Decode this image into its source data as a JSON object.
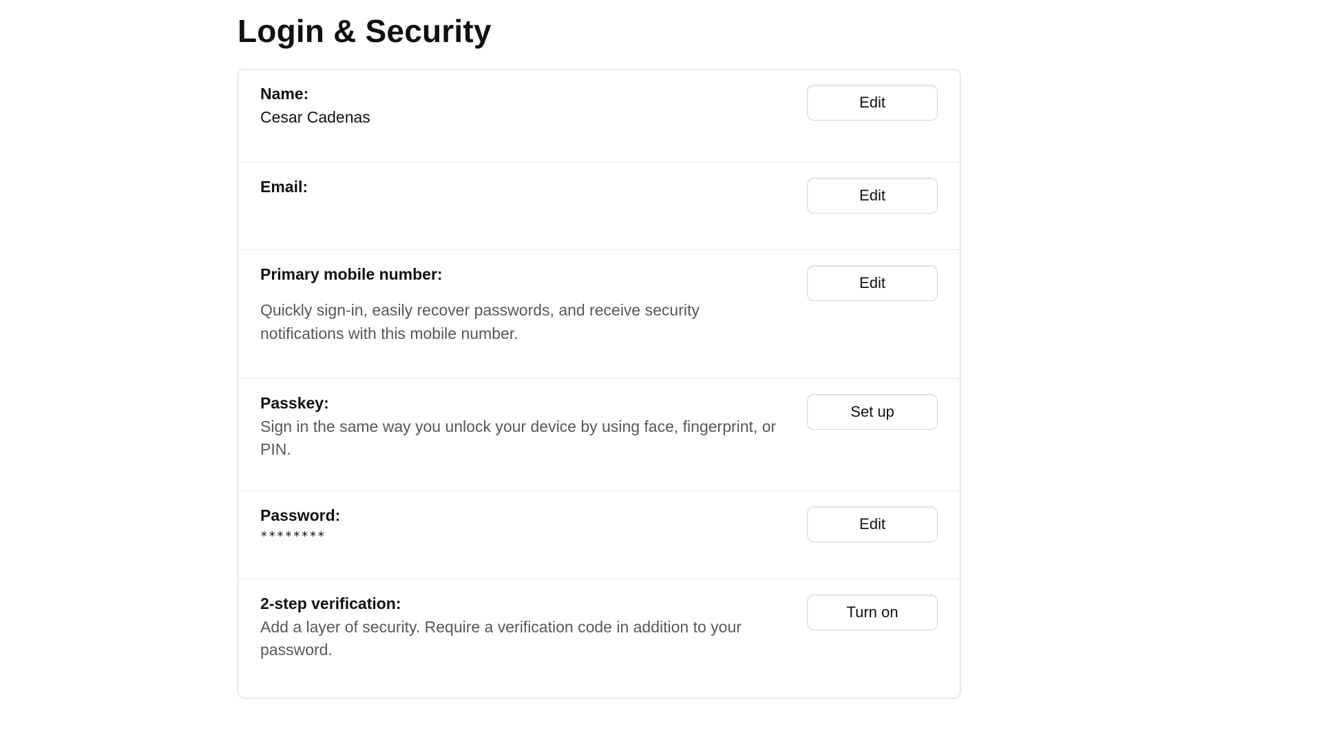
{
  "page": {
    "title": "Login & Security"
  },
  "rows": {
    "name": {
      "label": "Name:",
      "value": "Cesar Cadenas",
      "action": "Edit"
    },
    "email": {
      "label": "Email:",
      "value": "",
      "action": "Edit"
    },
    "mobile": {
      "label": "Primary mobile number:",
      "value": "",
      "description": "Quickly sign-in, easily recover passwords, and receive security notifications with this mobile number.",
      "action": "Edit"
    },
    "passkey": {
      "label": "Passkey:",
      "description": "Sign in the same way you unlock your device by using face, fingerprint, or PIN.",
      "action": "Set up"
    },
    "password": {
      "label": "Password:",
      "value": "********",
      "action": "Edit"
    },
    "twostep": {
      "label": "2-step verification:",
      "description": "Add a layer of security. Require a verification code in addition to your password.",
      "action": "Turn on"
    }
  }
}
